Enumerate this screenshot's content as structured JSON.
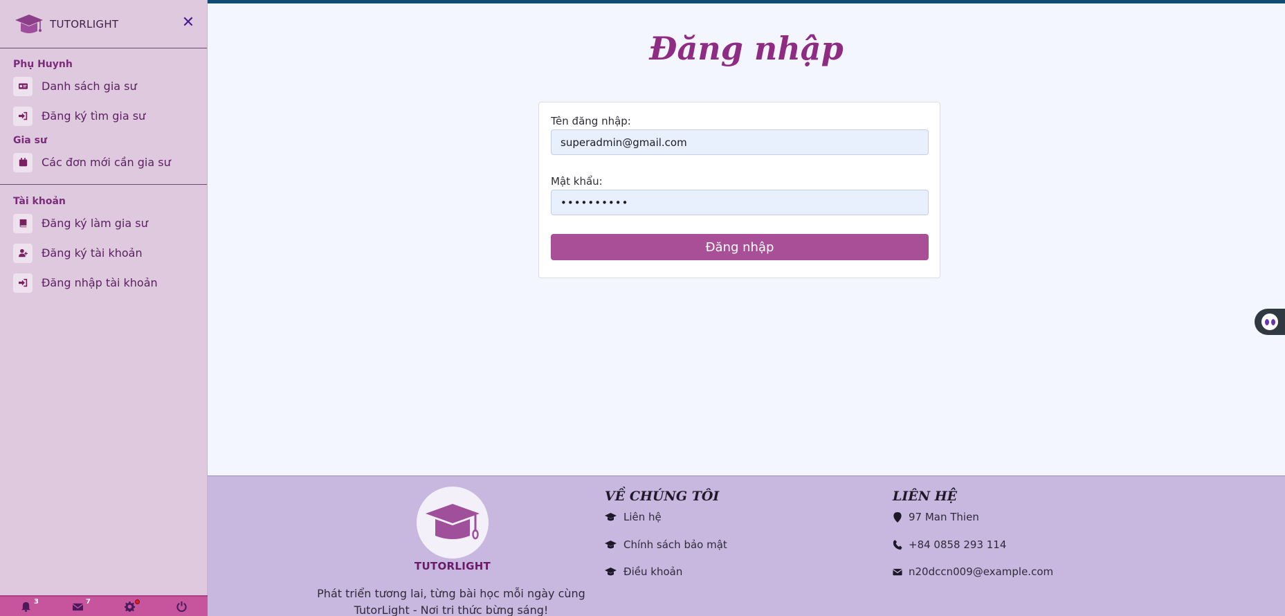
{
  "brand": {
    "name": "TUTORLIGHT"
  },
  "sidebar": {
    "sections": [
      {
        "title": "Phụ Huynh",
        "items": [
          {
            "label": "Danh sách gia sư",
            "icon": "id-card-icon"
          },
          {
            "label": "Đăng ký tìm gia sư",
            "icon": "sign-in-icon"
          }
        ]
      },
      {
        "title": "Gia sư",
        "items": [
          {
            "label": "Các đơn mới cần gia sư",
            "icon": "calendar-icon"
          }
        ]
      },
      {
        "title": "Tài khoản",
        "items": [
          {
            "label": "Đăng ký làm gia sư",
            "icon": "book-icon"
          },
          {
            "label": "Đăng ký tài khoản",
            "icon": "user-plus-icon"
          },
          {
            "label": "Đăng nhập tài khoản",
            "icon": "sign-in-icon"
          }
        ]
      }
    ],
    "footer": {
      "notifications_count": "3",
      "messages_count": "7"
    }
  },
  "login": {
    "title": "Đăng nhập",
    "username_label": "Tên đăng nhập:",
    "username_value": "superadmin@gmail.com",
    "password_label": "Mật khẩu:",
    "password_value": "••••••••••",
    "submit_label": "Đăng nhập"
  },
  "footer": {
    "brand": "TUTORLIGHT",
    "tagline": "Phát triển tương lai, từng bài học mỗi ngày cùng TutorLight - Nơi tri thức bừng sáng!",
    "about": {
      "title": "VỀ CHÚNG TÔI",
      "links": [
        "Liên hệ",
        "Chính sách bảo mật",
        "Điều khoản"
      ]
    },
    "contact": {
      "title": "LIÊN HỆ",
      "address": "97 Man Thien",
      "phone": "+84 0858 293 114",
      "email": "n20dccn009@example.com"
    }
  },
  "colors": {
    "accent": "#8e2c84",
    "button": "#a94f98",
    "sidebar_bg": "#dfc9df",
    "footer_bg": "#c8b8df",
    "sidebar_footer_bg": "#c7559e"
  }
}
